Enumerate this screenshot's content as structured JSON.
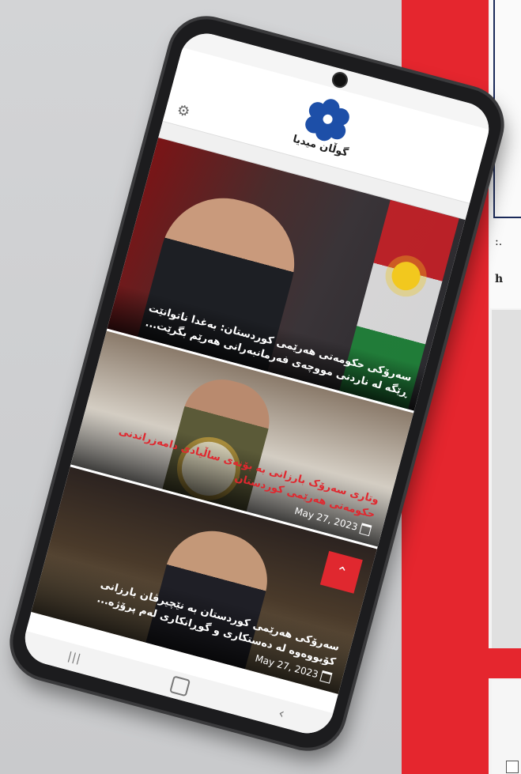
{
  "status_bar": {
    "left": "",
    "right": ""
  },
  "header": {
    "app_name": "گوڵان میدیا"
  },
  "cards": [
    {
      "title": "سەرۆکی حکومەتی هەرێمی کوردستان: بەغدا ناتوانێت ڕێگە لە ناردنی مووچەی فەرمانبەرانی هەرێم بگرێت...",
      "date": ""
    },
    {
      "title": "وتاری سەرۆک بارزانی بە بۆنەی ساڵیادی دامەزراندنی حکومەتی هەرێمی کوردستان",
      "date": "May 27, 2023"
    },
    {
      "title": "سەرۆکی هەرێمی کوردستان بە نێچیرڤان بارزانی کۆبووەوە لە دەستکاری و گوڕانکاری لەم پرۆژە...",
      "date": "May 27, 2023"
    }
  ],
  "share_badge": {
    "icon": "share-icon"
  },
  "side_panel": {
    "line1": ":.",
    "line2": "h"
  },
  "nav": {
    "back": "back-icon",
    "home": "home-icon",
    "recents": "recents-icon"
  },
  "colors": {
    "accent_red": "#e5262e",
    "logo_blue": "#1d4fa8"
  }
}
